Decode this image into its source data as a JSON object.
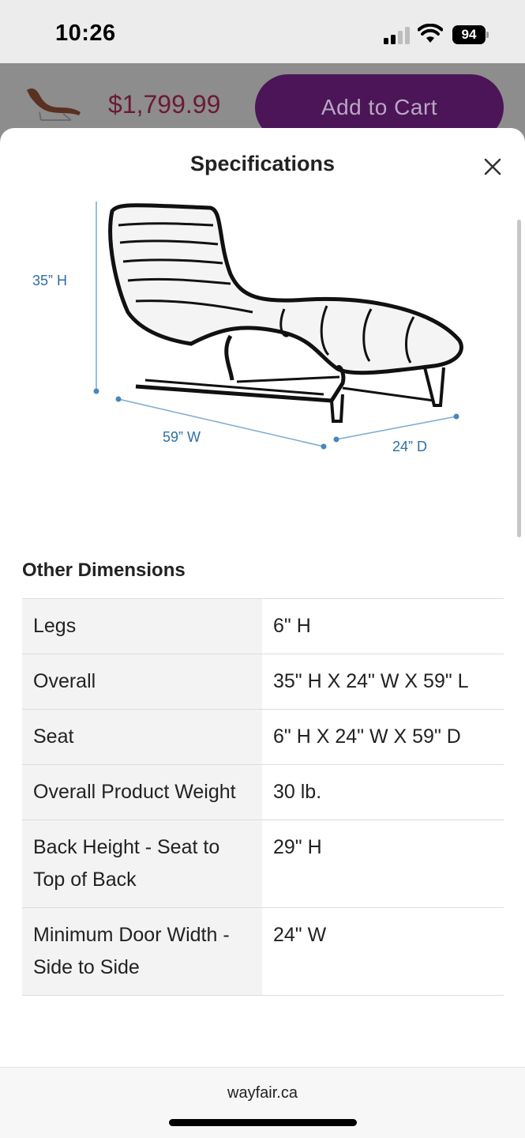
{
  "status_bar": {
    "time": "10:26",
    "battery": "94"
  },
  "cart_bar": {
    "price": "$1,799.99",
    "add_to_cart_label": "Add to Cart"
  },
  "sheet": {
    "title": "Specifications",
    "dimensions_graphic": {
      "height": "35” H",
      "width": "59” W",
      "depth": "24” D"
    }
  },
  "other_dimensions": {
    "heading": "Other Dimensions",
    "rows": [
      {
        "label": "Legs",
        "value": "6\" H"
      },
      {
        "label": "Overall",
        "value": "35\" H X 24\" W X 59\" L"
      },
      {
        "label": "Seat",
        "value": "6\" H X 24\" W X 59\" D"
      },
      {
        "label": "Overall Product Weight",
        "value": "30 lb."
      },
      {
        "label": "Back Height - Seat to Top of Back",
        "value": "29\" H"
      },
      {
        "label": "Minimum Door Width - Side to Side",
        "value": "24\" W"
      }
    ]
  },
  "browser": {
    "domain": "wayfair.ca"
  },
  "colors": {
    "brand_purple": "#4b1558",
    "dimension_blue": "#2d6ea8",
    "price_red": "#6b1a36"
  }
}
